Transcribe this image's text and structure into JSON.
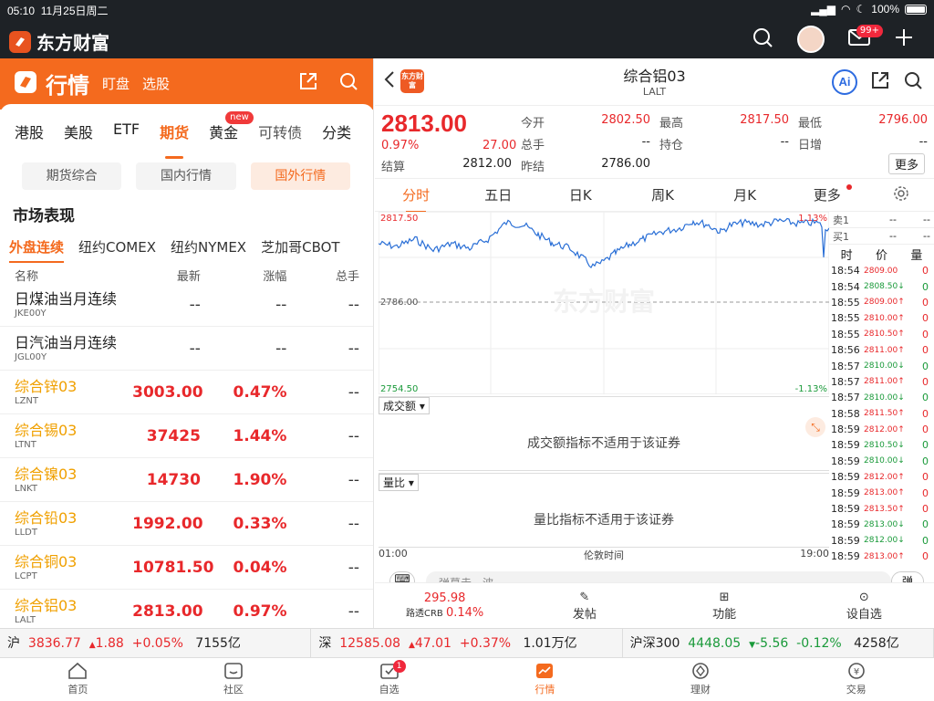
{
  "status": {
    "time": "05:10",
    "date": "11月25日周二",
    "battery": "100%"
  },
  "app": {
    "brand": "东方财富",
    "mail_badge": "99+"
  },
  "left": {
    "title": "行情",
    "tab1": "盯盘",
    "tab2": "选股",
    "cats": [
      "港股",
      "美股",
      "ETF",
      "期货",
      "黄金",
      "可转债",
      "分类"
    ],
    "new_badge": "new",
    "segs": [
      "期货综合",
      "国内行情",
      "国外行情"
    ],
    "market_title": "市场表现",
    "subtabs": [
      "外盘连续",
      "纽约COMEX",
      "纽约NYMEX",
      "芝加哥CBOT"
    ],
    "cols": [
      "名称",
      "最新",
      "涨幅",
      "总手"
    ],
    "rows": [
      {
        "name": "日煤油当月连续",
        "code": "JKE00Y",
        "last": "--",
        "chg": "--",
        "vol": "--",
        "hl": false
      },
      {
        "name": "日汽油当月连续",
        "code": "JGL00Y",
        "last": "--",
        "chg": "--",
        "vol": "--",
        "hl": false
      },
      {
        "name": "综合锌03",
        "code": "LZNT",
        "last": "3003.00",
        "chg": "0.47%",
        "vol": "--",
        "hl": true
      },
      {
        "name": "综合锡03",
        "code": "LTNT",
        "last": "37425",
        "chg": "1.44%",
        "vol": "--",
        "hl": true
      },
      {
        "name": "综合镍03",
        "code": "LNKT",
        "last": "14730",
        "chg": "1.90%",
        "vol": "--",
        "hl": true
      },
      {
        "name": "综合铅03",
        "code": "LLDT",
        "last": "1992.00",
        "chg": "0.33%",
        "vol": "--",
        "hl": true
      },
      {
        "name": "综合铜03",
        "code": "LCPT",
        "last": "10781.50",
        "chg": "0.04%",
        "vol": "--",
        "hl": true
      },
      {
        "name": "综合铝03",
        "code": "LALT",
        "last": "2813.00",
        "chg": "0.97%",
        "vol": "--",
        "hl": true
      }
    ]
  },
  "right": {
    "name": "综合铝03",
    "code": "LALT",
    "logo": "东方财富",
    "ai": "Ai",
    "price": "2813.00",
    "pct": "0.97%",
    "chg": "27.00",
    "q": {
      "open_l": "今开",
      "open": "2802.50",
      "high_l": "最高",
      "high": "2817.50",
      "low_l": "最低",
      "low": "2796.00",
      "vol_l": "总手",
      "vol": "--",
      "oi_l": "持仓",
      "oi": "--",
      "inc_l": "日增",
      "inc": "--",
      "set_l": "结算",
      "set": "2812.00",
      "pset_l": "昨结",
      "pset": "2786.00",
      "more": "更多"
    },
    "ctabs": [
      "分时",
      "五日",
      "日K",
      "周K",
      "月K",
      "更多"
    ],
    "chart": {
      "hi": "2817.50",
      "mid": "2786.00",
      "lo": "2754.50",
      "hi_pct": "1.13%",
      "lo_pct": "-1.13%",
      "watermark": "东方财富"
    },
    "ob": {
      "sell": "卖1",
      "buy": "买1",
      "dash": "--",
      "h_time": "时",
      "h_price": "价",
      "h_vol": "量"
    },
    "ticks": [
      {
        "t": "18:54",
        "p": "2809.00",
        "d": "",
        "v": "0",
        "c": "red"
      },
      {
        "t": "18:54",
        "p": "2808.50↓",
        "d": "",
        "v": "0",
        "c": "grn"
      },
      {
        "t": "18:55",
        "p": "2809.00↑",
        "d": "",
        "v": "0",
        "c": "red"
      },
      {
        "t": "18:55",
        "p": "2810.00↑",
        "d": "",
        "v": "0",
        "c": "red"
      },
      {
        "t": "18:55",
        "p": "2810.50↑",
        "d": "",
        "v": "0",
        "c": "red"
      },
      {
        "t": "18:56",
        "p": "2811.00↑",
        "d": "",
        "v": "0",
        "c": "red"
      },
      {
        "t": "18:57",
        "p": "2810.00↓",
        "d": "",
        "v": "0",
        "c": "grn"
      },
      {
        "t": "18:57",
        "p": "2811.00↑",
        "d": "",
        "v": "0",
        "c": "red"
      },
      {
        "t": "18:57",
        "p": "2810.00↓",
        "d": "",
        "v": "0",
        "c": "grn"
      },
      {
        "t": "18:58",
        "p": "2811.50↑",
        "d": "",
        "v": "0",
        "c": "red"
      },
      {
        "t": "18:59",
        "p": "2812.00↑",
        "d": "",
        "v": "0",
        "c": "red"
      },
      {
        "t": "18:59",
        "p": "2810.50↓",
        "d": "",
        "v": "0",
        "c": "grn"
      },
      {
        "t": "18:59",
        "p": "2810.00↓",
        "d": "",
        "v": "0",
        "c": "grn"
      },
      {
        "t": "18:59",
        "p": "2812.00↑",
        "d": "",
        "v": "0",
        "c": "red"
      },
      {
        "t": "18:59",
        "p": "2813.00↑",
        "d": "",
        "v": "0",
        "c": "red"
      },
      {
        "t": "18:59",
        "p": "2813.50↑",
        "d": "",
        "v": "0",
        "c": "red"
      },
      {
        "t": "18:59",
        "p": "2813.00↓",
        "d": "",
        "v": "0",
        "c": "grn"
      },
      {
        "t": "18:59",
        "p": "2812.00↓",
        "d": "",
        "v": "0",
        "c": "grn"
      },
      {
        "t": "18:59",
        "p": "2813.00↑",
        "d": "",
        "v": "0",
        "c": "red"
      }
    ],
    "ind1": {
      "label": "成交额",
      "msg": "成交额指标不适用于该证券"
    },
    "ind2": {
      "label": "量比",
      "msg": "量比指标不适用于该证券"
    },
    "time": {
      "start": "01:00",
      "mid": "伦敦时间",
      "end": "19:00"
    },
    "comment_ph": "弹幕走一波",
    "danmu": "弹",
    "bottom": {
      "crb_val": "295.98",
      "crb_l": "路透CRB",
      "crb_pct": "0.14%",
      "post": "发帖",
      "func": "功能",
      "fav": "设自选"
    }
  },
  "indices": [
    {
      "n": "沪",
      "v": "3836.77",
      "c": "1.88",
      "p": "+0.05%",
      "a": "7155亿"
    },
    {
      "n": "深",
      "v": "12585.08",
      "c": "47.01",
      "p": "+0.37%",
      "a": "1.01万亿"
    },
    {
      "n": "沪深300",
      "v": "4448.05",
      "c": "-5.56",
      "p": "-0.12%",
      "a": "4258亿"
    }
  ],
  "nav": {
    "items": [
      "首页",
      "社区",
      "自选",
      "行情",
      "理财",
      "交易"
    ],
    "badge": "1"
  }
}
